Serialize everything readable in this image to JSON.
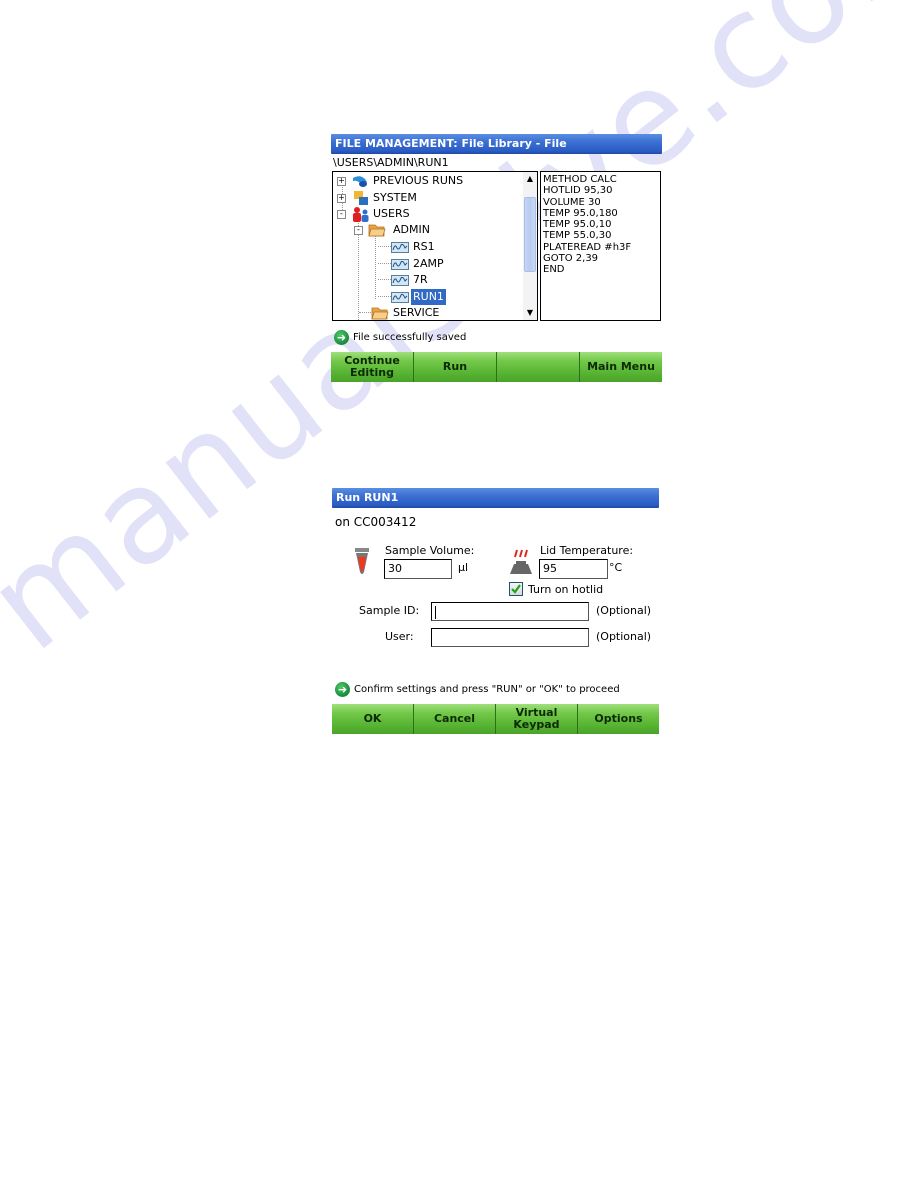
{
  "file_management": {
    "title": "FILE MANAGEMENT: File Library - File",
    "path": "\\USERS\\ADMIN\\RUN1",
    "tree": [
      {
        "label": "PREVIOUS RUNS",
        "icon": "previous-runs-icon",
        "expander": "+",
        "level": 0
      },
      {
        "label": "SYSTEM",
        "icon": "system-icon",
        "expander": "+",
        "level": 0
      },
      {
        "label": "USERS",
        "icon": "users-icon",
        "expander": "-",
        "level": 0
      },
      {
        "label": "ADMIN",
        "icon": "folder-icon",
        "expander": "-",
        "level": 1
      },
      {
        "label": "RS1",
        "icon": "protocol-file-icon",
        "level": 2
      },
      {
        "label": "2AMP",
        "icon": "protocol-file-icon",
        "level": 2
      },
      {
        "label": "7R",
        "icon": "protocol-file-icon",
        "level": 2
      },
      {
        "label": "RUN1",
        "icon": "protocol-file-icon",
        "level": 2,
        "selected": true
      },
      {
        "label": "SERVICE",
        "icon": "folder-icon",
        "level": 1
      }
    ],
    "method_lines": [
      "METHOD CALC",
      "HOTLID 95,30",
      "VOLUME 30",
      "TEMP 95.0,180",
      "TEMP 95.0,10",
      "TEMP 55.0,30",
      "PLATEREAD #h3F",
      "GOTO 2,39",
      "END"
    ],
    "status": "File successfully saved",
    "buttons": [
      "Continue\nEditing",
      "Run",
      "",
      "Main Menu"
    ]
  },
  "run_dialog": {
    "title": "Run RUN1",
    "instrument": "on CC003412",
    "sample_volume_label": "Sample Volume:",
    "sample_volume_value": "30",
    "sample_volume_unit": "µl",
    "lid_temp_label": "Lid Temperature:",
    "lid_temp_value": "95",
    "lid_temp_unit": "°C",
    "hotlid_checkbox_label": "Turn on hotlid",
    "hotlid_checked": true,
    "sample_id_label": "Sample ID:",
    "sample_id_value": "",
    "user_label": "User:",
    "user_value": "",
    "optional_text": "(Optional)",
    "status": "Confirm settings and press \"RUN\" or \"OK\" to proceed",
    "buttons": [
      "OK",
      "Cancel",
      "Virtual\nKeypad",
      "Options"
    ]
  },
  "watermark": "manualshive.com",
  "colors": {
    "title_bar": "#2a5cc4",
    "button_green": "#58b433",
    "selection": "#316ac5",
    "watermark": "#c9c9f2"
  }
}
